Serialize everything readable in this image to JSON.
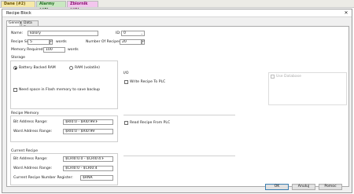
{
  "doc_tabs": [
    "Dane (#2)",
    "Alarmy (#3)",
    "Zbiornik (#1)"
  ],
  "dialog": {
    "title": "Recipe Block",
    "tabs": [
      "General",
      "Data Devs"
    ]
  },
  "general": {
    "name_label": "Name:",
    "name_value": "kolory",
    "id_label": "ID:",
    "id_value": "0",
    "recipe_size_label": "Recipe Size:",
    "recipe_size_value": "5",
    "words_unit": "words",
    "num_recipes_label": "Number Of Recipes:",
    "num_recipes_value": "20",
    "memory_required_label": "Memory Required:",
    "memory_required_value": "100",
    "memory_required_unit": "words"
  },
  "storage": {
    "title": "Storage",
    "option_battery": "Battery Backed RAM",
    "option_ram": "RAM (volatile)",
    "flash_note": "Need space in Flash memory to save backup"
  },
  "recipe_memory": {
    "title": "Recipe Memory",
    "bit_label": "Bit Address Range:",
    "bit_value": "$RI0:0 - $RI0:99:F",
    "word_label": "Word Address Range:",
    "word_value": "$RI0:0 - $RI0:99"
  },
  "current_recipe": {
    "title": "Current Recipe",
    "bit_label": "Bit Address Range:",
    "bit_value": "$CRI0:0.0 - $CRI0:4:F",
    "word_label": "Word Address Range:",
    "word_value": "$CRI0:0 - $CRI0:4",
    "number_label": "Current Recipe Number Register:",
    "number_value": "$RNR"
  },
  "io": {
    "title": "I/O",
    "write_label": "Write Recipe To PLC",
    "read_label": "Read Recipe From PLC",
    "use_database": "Use Database"
  },
  "buttons": {
    "ok": "OK",
    "cancel": "Anuluj",
    "help": "Pomoc"
  }
}
